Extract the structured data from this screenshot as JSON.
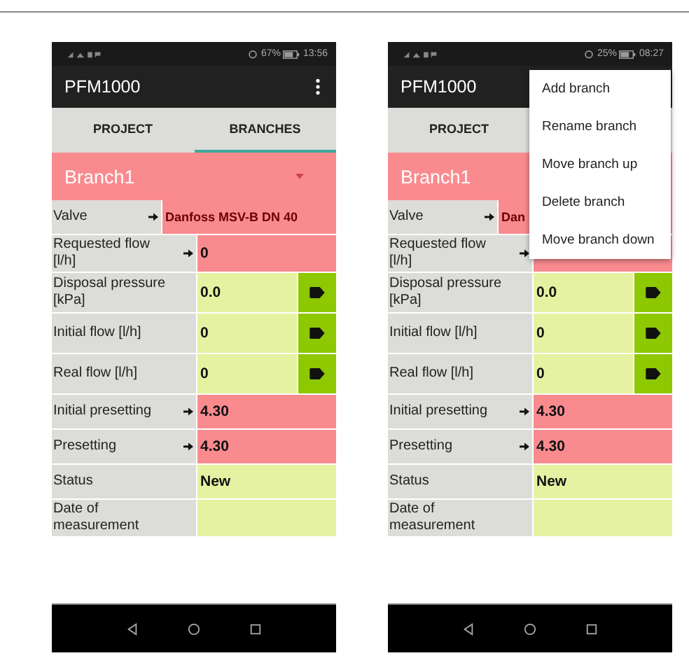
{
  "phones": [
    {
      "status_bar": {
        "battery": "67%",
        "time": "13:56"
      },
      "app_bar": {
        "title": "PFM1000",
        "overflow_menu": true
      },
      "tabs": [
        {
          "label": "PROJECT",
          "selected": false
        },
        {
          "label": "BRANCHES",
          "selected": true
        }
      ],
      "branch_selector": {
        "value": "Branch1"
      },
      "rows": [
        {
          "kind": "picker",
          "label": "Valve",
          "arrow": true,
          "value": "Danfoss MSV-B  DN 40",
          "color": "#f98b8f"
        },
        {
          "kind": "field",
          "label": "Requested flow [l/h]",
          "arrow": true,
          "value": "0",
          "color": "#f98b8f"
        },
        {
          "kind": "measured",
          "label": "Disposal pressure [kPa]",
          "arrow": false,
          "value": "0.0",
          "color": "#e5f2a2"
        },
        {
          "kind": "measured",
          "label": "Initial flow [l/h]",
          "arrow": false,
          "value": "0",
          "color": "#e5f2a2"
        },
        {
          "kind": "measured",
          "label": "Real flow [l/h]",
          "arrow": false,
          "value": "0",
          "color": "#e5f2a2"
        },
        {
          "kind": "field",
          "label": "Initial presetting",
          "arrow": true,
          "value": "4.30",
          "color": "#f98b8f"
        },
        {
          "kind": "field",
          "label": "Presetting",
          "arrow": true,
          "value": "4.30",
          "color": "#f98b8f"
        },
        {
          "kind": "field",
          "label": "Status",
          "arrow": false,
          "value": "New",
          "color": "#e5f2a2"
        },
        {
          "kind": "field",
          "label": "Date of measurement",
          "arrow": false,
          "color": "#e5f2a2"
        }
      ]
    },
    {
      "status_bar": {
        "battery": "25%",
        "time": "08:27"
      },
      "app_bar": {
        "title": "PFM1000",
        "overflow_menu": false
      },
      "tabs": [
        {
          "label": "PROJECT",
          "selected": false
        }
      ],
      "branch_selector": {
        "value": "Branch1"
      },
      "rows": [
        {
          "kind": "picker",
          "label": "Valve",
          "arrow": true,
          "value": "Dan",
          "color": "#f98b8f"
        },
        {
          "kind": "field",
          "label": "Requested flow [l/h]",
          "arrow": true,
          "color": "#f98b8f"
        },
        {
          "kind": "measured",
          "label": "Disposal pressure [kPa]",
          "arrow": false,
          "value": "0.0",
          "color": "#e5f2a2"
        },
        {
          "kind": "measured",
          "label": "Initial flow [l/h]",
          "arrow": false,
          "value": "0",
          "color": "#e5f2a2"
        },
        {
          "kind": "measured",
          "label": "Real flow [l/h]",
          "arrow": false,
          "value": "0",
          "color": "#e5f2a2"
        },
        {
          "kind": "field",
          "label": "Initial presetting",
          "arrow": true,
          "value": "4.30",
          "color": "#f98b8f"
        },
        {
          "kind": "field",
          "label": "Presetting",
          "arrow": true,
          "value": "4.30",
          "color": "#f98b8f"
        },
        {
          "kind": "field",
          "label": "Status",
          "arrow": false,
          "value": "New",
          "color": "#e5f2a2"
        },
        {
          "kind": "field",
          "label": "Date of measurement",
          "arrow": false,
          "color": "#e5f2a2"
        }
      ],
      "menu": [
        "Add branch",
        "Rename branch",
        "Move branch up",
        "Delete branch",
        "Move branch down"
      ]
    }
  ]
}
